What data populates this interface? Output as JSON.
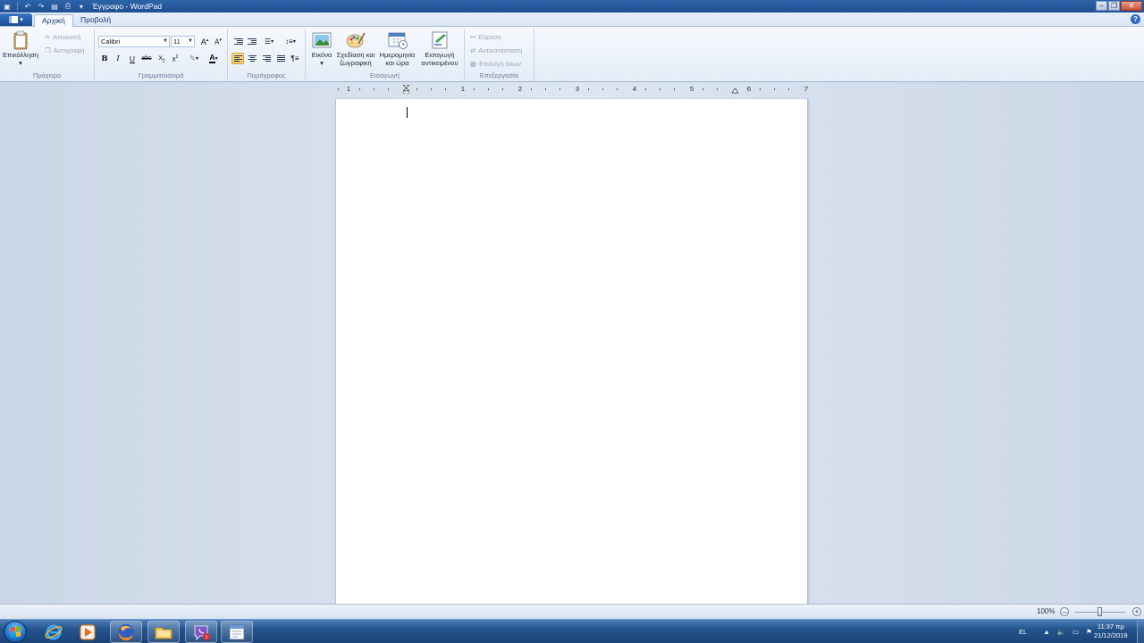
{
  "window": {
    "title": "Έγγραφο - WordPad"
  },
  "quick_access": {
    "icons": [
      "save-icon",
      "undo-icon",
      "redo-icon",
      "print-preview-icon",
      "customize-dropdown-icon"
    ]
  },
  "tabs": [
    {
      "label": "Αρχική",
      "active": true
    },
    {
      "label": "Προβολή",
      "active": false
    }
  ],
  "ribbon": {
    "clipboard": {
      "group_label": "Πρόχειρο",
      "paste": "Επικόλληση",
      "cut": "Αποκοπή",
      "copy": "Αντιγραφή"
    },
    "font": {
      "group_label": "Γραμματοσειρά",
      "family": "Calibri",
      "size": "11"
    },
    "paragraph": {
      "group_label": "Παράγραφος"
    },
    "insert": {
      "group_label": "Εισαγωγή",
      "picture": "Εικόνα",
      "paint_line1": "Σχεδίαση και",
      "paint_line2": "ζωγραφική",
      "datetime_line1": "Ημερομηνία",
      "datetime_line2": "και ώρα",
      "object_line1": "Εισαγωγή",
      "object_line2": "αντικειμένου"
    },
    "editing": {
      "group_label": "Επεξεργασία",
      "find": "Εύρεση",
      "replace": "Αντικατάσταση",
      "select_all": "Επιλογή όλων"
    }
  },
  "ruler": {
    "labels": [
      "1",
      "1",
      "2",
      "3",
      "4",
      "5",
      "6",
      "7"
    ]
  },
  "status": {
    "zoom": "100%"
  },
  "taskbar": {
    "language": "EL",
    "time": "11:37 πμ",
    "date": "21/12/2019",
    "apps": [
      "internet-explorer-icon",
      "media-player-icon",
      "firefox-icon",
      "file-explorer-icon",
      "viber-icon",
      "wordpad-icon"
    ],
    "viber_badge": "1"
  },
  "colors": {
    "accent": "#2d64a9",
    "taskbar": "#24548e",
    "selected": "#f6c35a"
  }
}
